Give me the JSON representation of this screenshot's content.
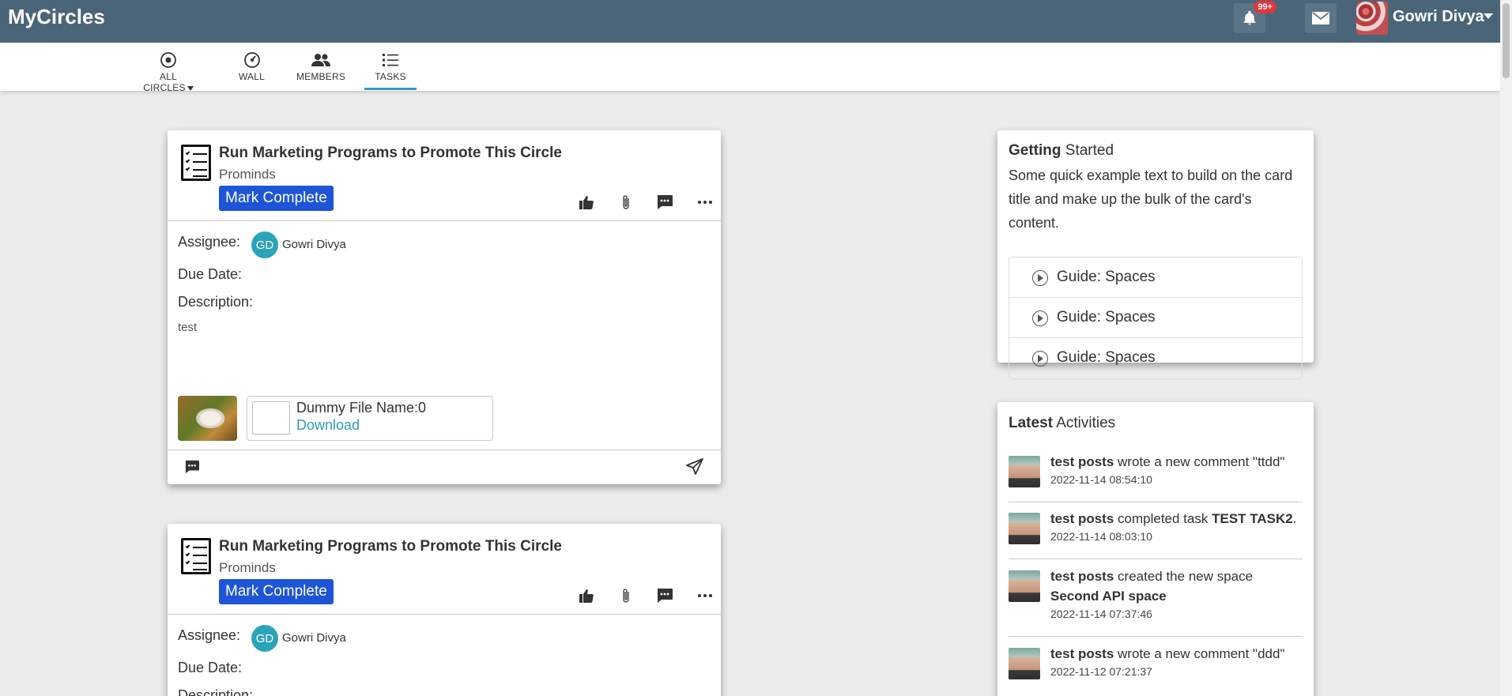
{
  "app": {
    "brand": "MyCircles",
    "notification_badge": "99+",
    "user_name": "Gowri Divya"
  },
  "nav": {
    "items": [
      {
        "label": "ALL CIRCLES",
        "icon": "target-icon"
      },
      {
        "label": "WALL",
        "icon": "gauge-icon"
      },
      {
        "label": "MEMBERS",
        "icon": "people-icon"
      },
      {
        "label": "TASKS",
        "icon": "list-icon",
        "active": true
      }
    ]
  },
  "tasks": [
    {
      "title": "Run Marketing Programs to Promote This Circle",
      "circle": "Prominds",
      "mark_complete": "Mark Complete",
      "assignee_label": "Assignee:",
      "assignee_initials": "GD",
      "assignee_name": "Gowri Divya",
      "due_label": "Due Date:",
      "desc_label": "Description:",
      "description": "test",
      "file_name": "Dummy File Name:0",
      "file_download": "Download"
    },
    {
      "title": "Run Marketing Programs to Promote This Circle",
      "circle": "Prominds",
      "mark_complete": "Mark Complete",
      "assignee_label": "Assignee:",
      "assignee_initials": "GD",
      "assignee_name": "Gowri Divya",
      "due_label": "Due Date:",
      "desc_label": "Description:"
    }
  ],
  "getting_started": {
    "title_bold": "Getting",
    "title_rest": "Started",
    "text": "Some quick example text to build on the card title and make up the bulk of the card's content.",
    "guides": [
      "Guide: Spaces",
      "Guide: Spaces",
      "Guide: Spaces"
    ]
  },
  "activities": {
    "title_bold": "Latest",
    "title_rest": "Activities",
    "items": [
      {
        "user": "test posts",
        "text": "wrote a new comment \"ttdd\"",
        "time": "2022-11-14 08:54:10"
      },
      {
        "user": "test posts",
        "text": "completed task",
        "target": "TEST TASK2",
        "suffix": ".",
        "time": "2022-11-14 08:03:10"
      },
      {
        "user": "test posts",
        "text": "created the new space",
        "target": "Second API space",
        "time": "2022-11-14 07:37:46"
      },
      {
        "user": "test posts",
        "text": "wrote a new comment \"ddd\"",
        "time": "2022-11-12 07:21:37"
      }
    ]
  },
  "colors": {
    "topbar": "#4a6578",
    "accent": "#2e9bbd",
    "primary_button": "#1d55d6",
    "badge": "#e2353f"
  }
}
